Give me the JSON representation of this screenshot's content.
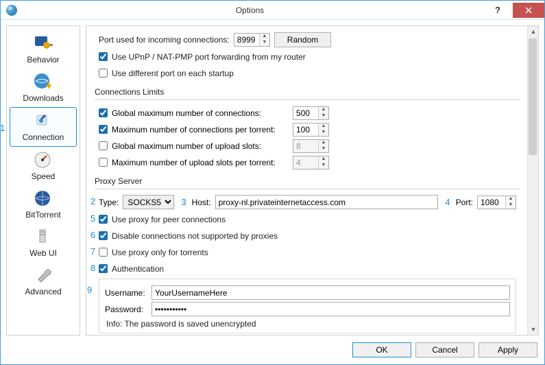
{
  "window": {
    "title": "Options"
  },
  "sidebar": {
    "items": [
      {
        "label": "Behavior"
      },
      {
        "label": "Downloads"
      },
      {
        "label": "Connection"
      },
      {
        "label": "Speed"
      },
      {
        "label": "BitTorrent"
      },
      {
        "label": "Web UI"
      },
      {
        "label": "Advanced"
      }
    ]
  },
  "listening": {
    "port_label": "Port used for incoming connections:",
    "port_value": "8999",
    "random_btn": "Random",
    "upnp_label": "Use UPnP / NAT-PMP port forwarding from my router",
    "upnp_checked": true,
    "diff_port_label": "Use different port on each startup",
    "diff_port_checked": false
  },
  "limits": {
    "group": "Connections Limits",
    "global_max_label": "Global maximum number of connections:",
    "global_max_value": "500",
    "global_max_checked": true,
    "max_per_torrent_label": "Maximum number of connections per torrent:",
    "max_per_torrent_value": "100",
    "max_per_torrent_checked": true,
    "global_upload_label": "Global maximum number of upload slots:",
    "global_upload_value": "8",
    "global_upload_checked": false,
    "upload_per_torrent_label": "Maximum number of upload slots per torrent:",
    "upload_per_torrent_value": "4",
    "upload_per_torrent_checked": false
  },
  "proxy": {
    "group": "Proxy Server",
    "type_label": "Type:",
    "type_value": "SOCKS5",
    "host_label": "Host:",
    "host_value": "proxy-nl.privateinternetaccess.com",
    "port_label": "Port:",
    "port_value": "1080",
    "use_peer_label": "Use proxy for peer connections",
    "use_peer_checked": true,
    "disable_unsupported_label": "Disable connections not supported by proxies",
    "disable_unsupported_checked": true,
    "only_torrents_label": "Use proxy only for torrents",
    "only_torrents_checked": false,
    "auth_label": "Authentication",
    "auth_checked": true,
    "username_label": "Username:",
    "username_value": "YourUsernameHere",
    "password_label": "Password:",
    "password_value": "•••••••••••",
    "info": "Info: The password is saved unencrypted"
  },
  "footer": {
    "ok": "OK",
    "cancel": "Cancel",
    "apply": "Apply"
  },
  "callouts": {
    "c1": "1",
    "c2": "2",
    "c3": "3",
    "c4": "4",
    "c5": "5",
    "c6": "6",
    "c7": "7",
    "c8": "8",
    "c9": "9"
  }
}
